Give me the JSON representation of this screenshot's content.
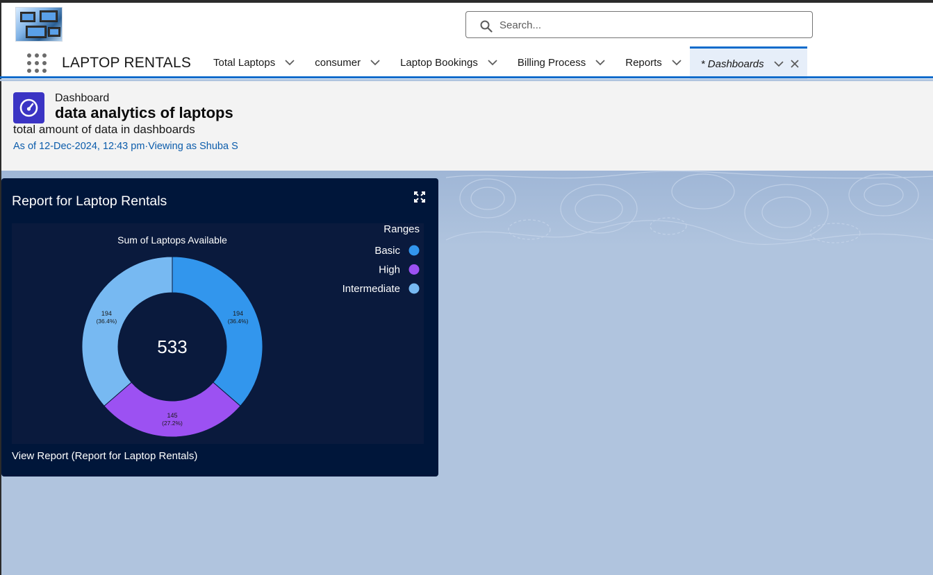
{
  "app": {
    "name": "LAPTOP RENTALS",
    "search_placeholder": "Search...",
    "icons": {
      "logo": "laptops-logo-image",
      "app_launcher": "app-launcher-grid-icon",
      "search": "search-icon",
      "tab_menu": "chevron-down-icon",
      "tab_close": "close-icon"
    }
  },
  "nav": {
    "tabs": [
      {
        "label": "Total Laptops"
      },
      {
        "label": "consumer"
      },
      {
        "label": "Laptop Bookings"
      },
      {
        "label": "Billing Process"
      },
      {
        "label": "Reports"
      },
      {
        "label": "* Dashboards",
        "active": true
      }
    ]
  },
  "dashboard": {
    "type_label": "Dashboard",
    "title": "data analytics of laptops",
    "description": "total amount of data in dashboards",
    "as_of": "As of 12-Dec-2024, 12:43 pm·Viewing as Shuba S"
  },
  "widget": {
    "title": "Report for Laptop Rentals",
    "view_report_link": "View Report (Report for Laptop Rentals)"
  },
  "chart_data": {
    "type": "pie",
    "variant": "donut",
    "title": "Sum of Laptops Available",
    "center_total": "533",
    "legend_title": "Ranges",
    "legend_placement": "top-right",
    "categories": [
      "Basic",
      "High",
      "Intermediate"
    ],
    "values": [
      194,
      145,
      194
    ],
    "labels": [
      {
        "value": "194",
        "percent": "(36.4%)"
      },
      {
        "value": "145",
        "percent": "(27.2%)"
      },
      {
        "value": "194",
        "percent": "(36.4%)"
      }
    ],
    "colors": [
      "#3296ed",
      "#9c51f2",
      "#77b9f2"
    ]
  },
  "colors": {
    "accent": "#0b6bcb",
    "dashboard_icon": "#3b34c4",
    "widget_bg": "#00163a"
  }
}
